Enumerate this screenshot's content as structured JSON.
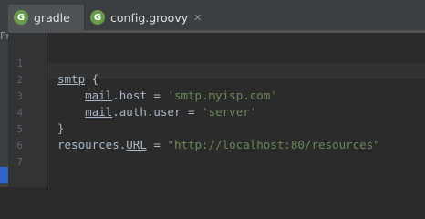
{
  "tabs": [
    {
      "label": "gradle",
      "icon": "gradle-icon",
      "active": true
    },
    {
      "label": "config.groovy",
      "icon": "groovy-file-icon",
      "active": false,
      "close": "✕"
    }
  ],
  "left_panel_fragment": "Pr",
  "line_numbers": [
    "1",
    "2",
    "3",
    "4",
    "5",
    "6",
    "7"
  ],
  "code": {
    "line2": {
      "key": "smtp",
      "brace": " {"
    },
    "line3": {
      "indent": "    ",
      "key1": "mail",
      "rest": ".host = ",
      "value": "'smtp.myisp.com'"
    },
    "line4": {
      "indent": "    ",
      "key1": "mail",
      "rest": ".auth.user = ",
      "value": "'server'"
    },
    "line5": {
      "text": "}"
    },
    "line6": {
      "key": "resources.",
      "prop": "URL",
      "rest": " = ",
      "value": "\"http://localhost:80/resources\""
    }
  },
  "colors": {
    "background": "#2b2b2b",
    "gutter": "#313335",
    "text": "#a9b7c6",
    "string": "#6a8759",
    "line_number": "#606366",
    "tab_active": "#4e5254",
    "groovy_icon": "#6a9c4e"
  }
}
